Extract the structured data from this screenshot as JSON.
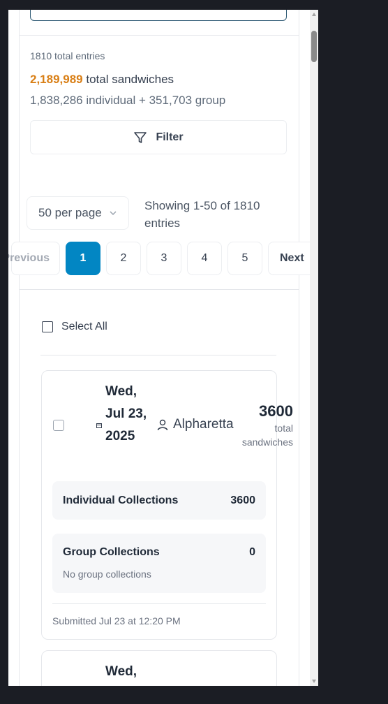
{
  "summary": {
    "total_entries": "1810 total entries",
    "total_sandwiches_value": "2,189,989",
    "total_sandwiches_label": "total sandwiches",
    "breakdown": "1,838,286 individual + 351,703 group"
  },
  "filter": {
    "label": "Filter",
    "icon": "filter-icon"
  },
  "pagination": {
    "per_page": "50 per page",
    "showing": "Showing 1-50 of 1810 entries",
    "previous_label": "Previous",
    "next_label": "Next",
    "pages": [
      "1",
      "2",
      "3",
      "4",
      "5"
    ],
    "current_page": "1",
    "accent_color": "#0286c3"
  },
  "list": {
    "select_all_label": "Select All",
    "entries": [
      {
        "date": "Wed, Jul 23, 2025",
        "location": "Alpharetta",
        "total": "3600",
        "total_label": "total sandwiches",
        "individual_label": "Individual Collections",
        "individual_value": "3600",
        "group_label": "Group Collections",
        "group_value": "0",
        "group_note": "No group collections",
        "submitted": "Submitted Jul 23 at 12:20 PM"
      },
      {
        "date": "Wed,"
      }
    ]
  },
  "colors": {
    "highlight": "#d97f16",
    "background": "#1b1d24"
  }
}
